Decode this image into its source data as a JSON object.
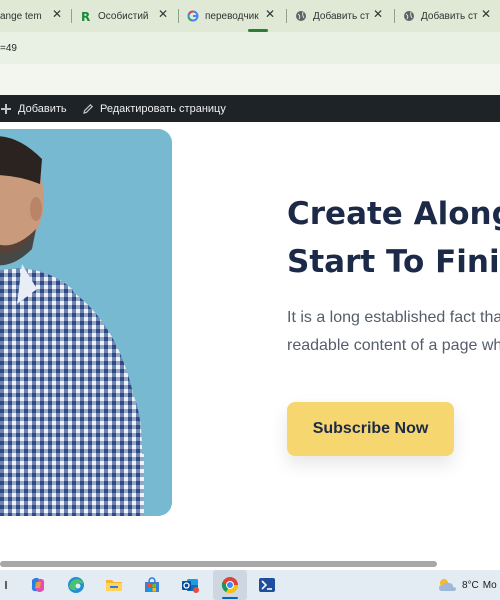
{
  "browser": {
    "tabs": [
      {
        "label": "ange tem",
        "icon": "page-icon"
      },
      {
        "label": "Особистий",
        "icon": "r-logo-icon"
      },
      {
        "label": "переводчик",
        "icon": "google-icon"
      },
      {
        "label": "Добавить ст",
        "icon": "globe-icon"
      },
      {
        "label": "Добавить ст",
        "icon": "globe-icon"
      }
    ],
    "close_glyph": "✕",
    "url": "=49"
  },
  "admin_bar": {
    "add_label": "Добавить",
    "edit_label": "Редактировать страницу"
  },
  "hero": {
    "heading_line1": "Create Along",
    "heading_line2": "Start To Finish",
    "paragraph_line1": "It is a long established fact that",
    "paragraph_line2": "readable content of a page when",
    "button_label": "Subscribe Now"
  },
  "taskbar": {
    "icons": [
      "copilot-icon",
      "edge-icon",
      "file-explorer-icon",
      "store-icon",
      "outlook-icon",
      "chrome-icon",
      "powershell-icon"
    ],
    "weather": {
      "temp": "8°C",
      "text": "Mo"
    }
  },
  "colors": {
    "heading": "#1c2a48",
    "button_bg": "#f6d66e",
    "admin_bar": "#1d2327",
    "photo_bg": "#78b9d2"
  }
}
